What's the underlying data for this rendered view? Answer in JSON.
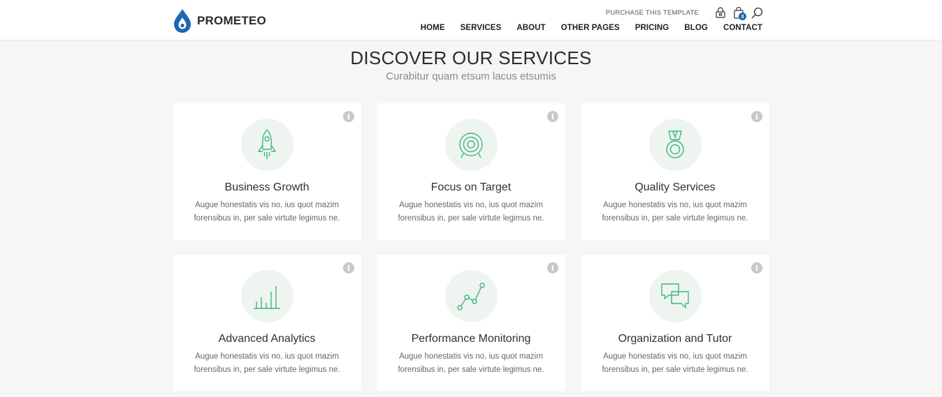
{
  "brand": {
    "name": "PROMETEO",
    "color": "#1d66b0"
  },
  "header": {
    "purchase": "PURCHASE THIS TEMPLATE",
    "cart_count": "3",
    "nav": [
      "HOME",
      "SERVICES",
      "ABOUT",
      "OTHER PAGES",
      "PRICING",
      "BLOG",
      "CONTACT"
    ]
  },
  "section": {
    "title": "DISCOVER OUR SERVICES",
    "subtitle": "Curabitur quam etsum lacus etsumis"
  },
  "accent_color": "#3fb67a",
  "cards": [
    {
      "icon": "rocket-icon",
      "title": "Business Growth",
      "text": "Augue honestatis vis no, ius quot mazim forensibus in, per sale virtute legimus ne."
    },
    {
      "icon": "target-icon",
      "title": "Focus on Target",
      "text": "Augue honestatis vis no, ius quot mazim forensibus in, per sale virtute legimus ne."
    },
    {
      "icon": "medal-icon",
      "title": "Quality Services",
      "text": "Augue honestatis vis no, ius quot mazim forensibus in, per sale virtute legimus ne."
    },
    {
      "icon": "bar-chart-icon",
      "title": "Advanced Analytics",
      "text": "Augue honestatis vis no, ius quot mazim forensibus in, per sale virtute legimus ne."
    },
    {
      "icon": "line-graph-icon",
      "title": "Performance Monitoring",
      "text": "Augue honestatis vis no, ius quot mazim forensibus in, per sale virtute legimus ne."
    },
    {
      "icon": "chat-bubbles-icon",
      "title": "Organization and Tutor",
      "text": "Augue honestatis vis no, ius quot mazim forensibus in, per sale virtute legimus ne."
    }
  ],
  "icons": {
    "info": "info-icon",
    "lock": "lock-icon",
    "cart": "shopping-bag-icon",
    "search": "search-icon",
    "logo": "drop-logo-icon"
  }
}
